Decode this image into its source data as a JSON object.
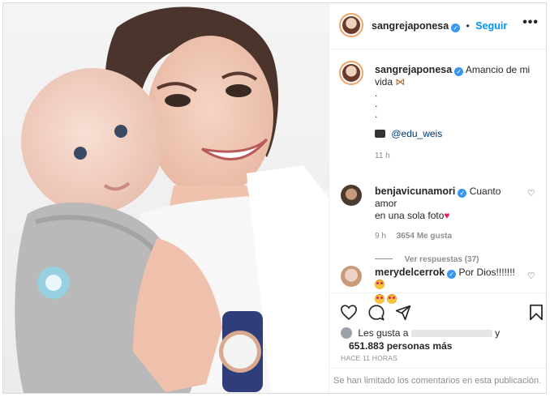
{
  "header": {
    "username": "sangrejaponesa",
    "separator": "•",
    "follow_label": "Seguir",
    "more": "•••"
  },
  "caption": {
    "username": "sangrejaponesa",
    "text_line1": "Amancio de mi",
    "text_line2": "vida",
    "dots": [
      ".",
      ".",
      "."
    ],
    "mention": "@edu_weis",
    "time": "11 h"
  },
  "comments": [
    {
      "username": "benjavicunamori",
      "text_line1": "Cuanto amor",
      "text_line2": "en una sola foto",
      "time": "9 h",
      "likes": "3654 Me gusta",
      "replies": "Ver respuestas (37)"
    },
    {
      "username": "merydelcerrok",
      "text": "Por Dios!!!!!!!"
    }
  ],
  "likes": {
    "prefix": "Les gusta a",
    "suffix": "y",
    "count": "651.883 personas más"
  },
  "timestamp": "HACE 11 HORAS",
  "comments_limited": "Se han limitado los comentarios en esta publicación.",
  "colors": {
    "link": "#0095f6",
    "verified": "#3897f0",
    "muted": "#8e8e8e",
    "text": "#262626"
  },
  "icons": [
    "heart-icon",
    "comment-icon",
    "share-icon",
    "bookmark-icon",
    "more-icon",
    "verified-icon",
    "camera-icon",
    "butterfly-icon",
    "red-heart-icon",
    "heart-eyes-emoji-icon"
  ]
}
